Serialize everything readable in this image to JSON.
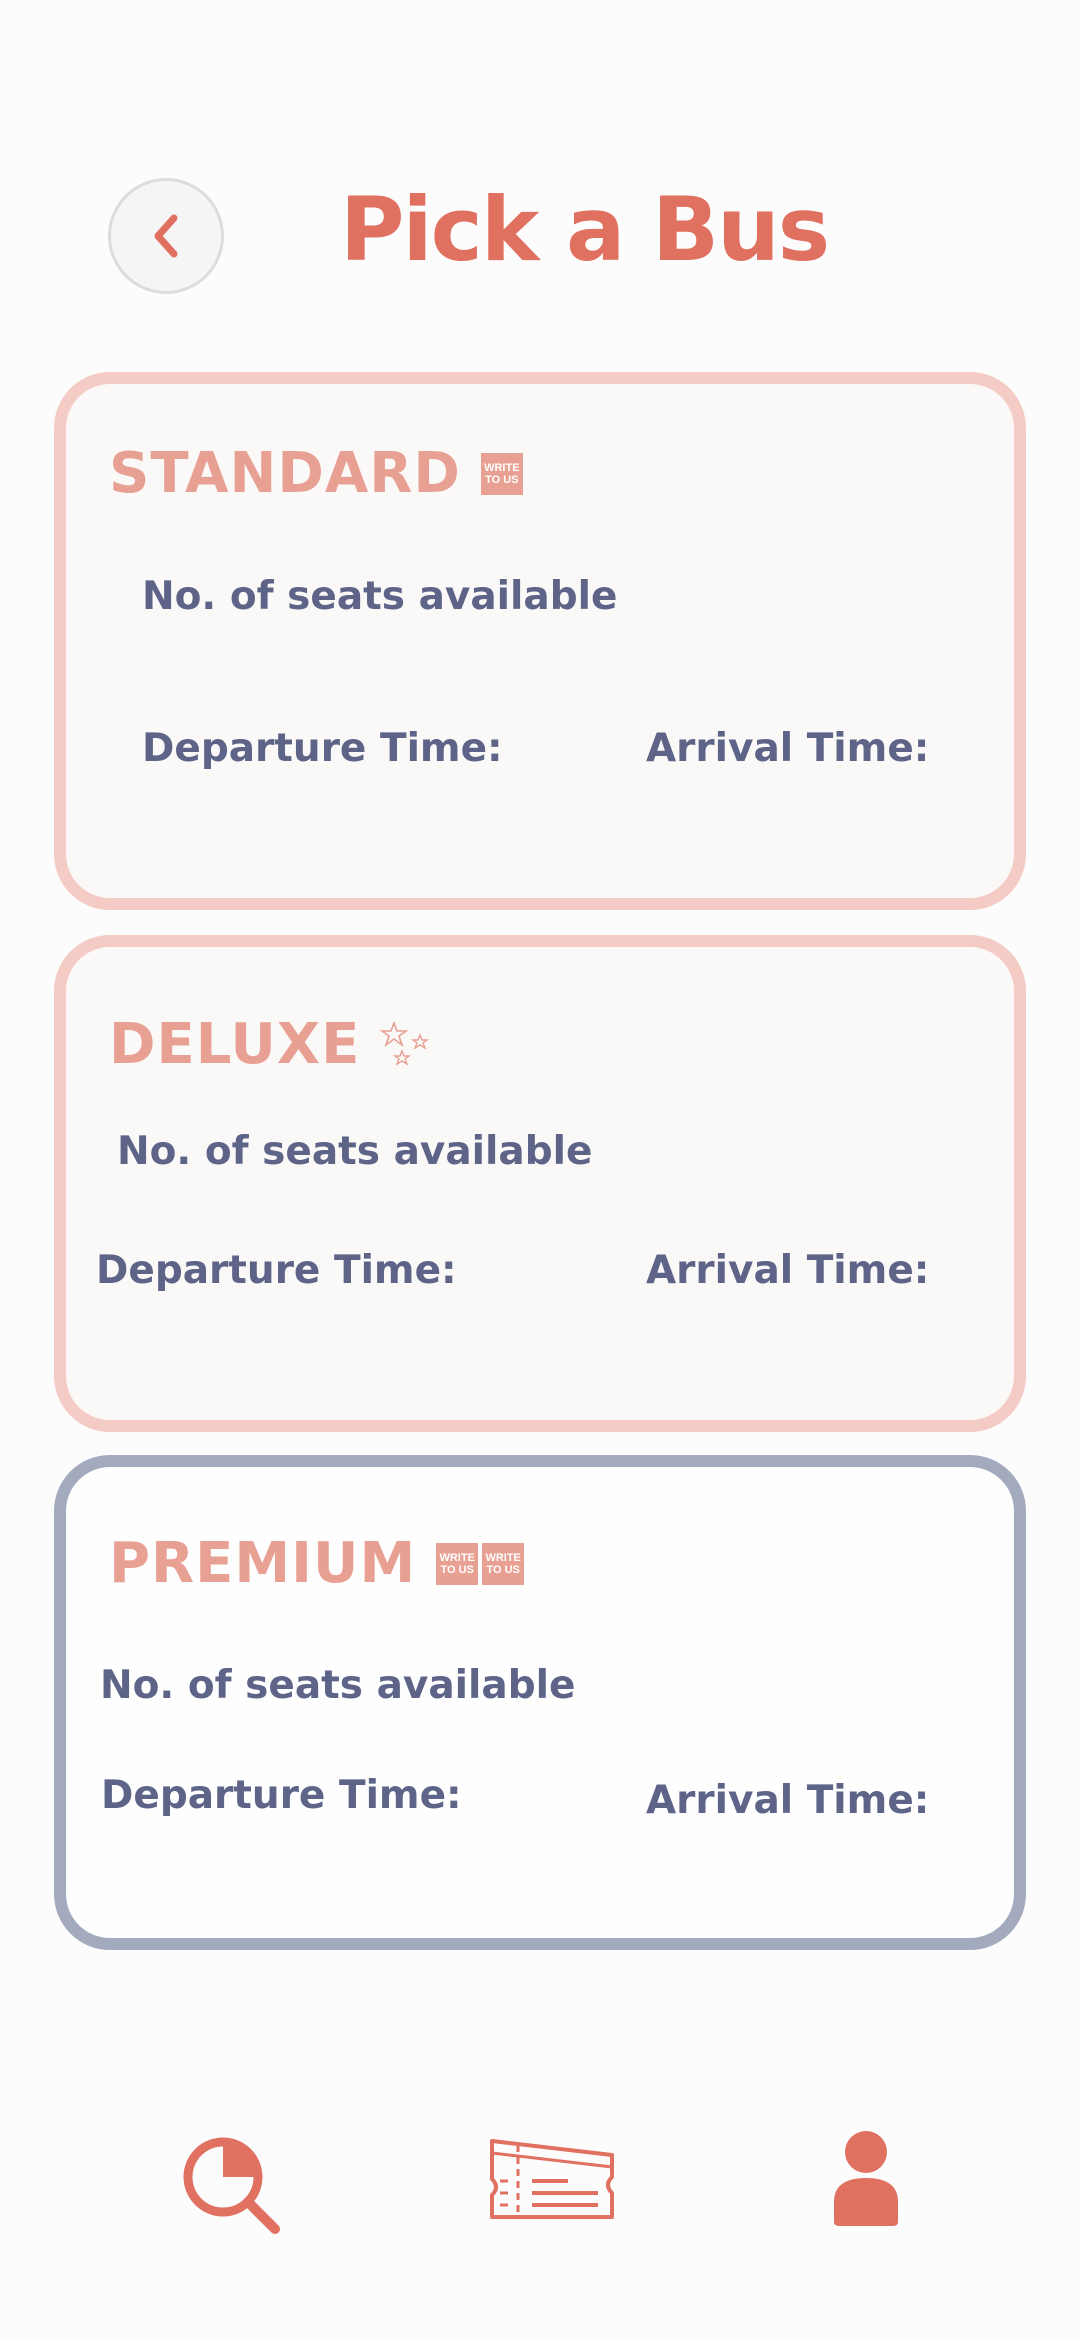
{
  "header": {
    "title": "Pick a Bus",
    "back_icon": "chevron-left-icon"
  },
  "colors": {
    "accent": "#e07060",
    "tier_label": "#e8a093",
    "text": "#5d6488",
    "card_border": "#f4cbc5",
    "premium_border": "#a4aabd"
  },
  "buses": [
    {
      "tier": "STANDARD",
      "badge_icons": [
        "write-to-us-icon"
      ],
      "seats_label": "No. of seats available",
      "departure_label": "Departure Time:",
      "arrival_label": "Arrival Time:"
    },
    {
      "tier": "DELUXE",
      "badge_icons": [
        "stars-icon"
      ],
      "seats_label": "No. of seats available",
      "departure_label": "Departure Time:",
      "arrival_label": "Arrival Time:"
    },
    {
      "tier": "PREMIUM",
      "badge_icons": [
        "write-to-us-icon",
        "write-to-us-icon"
      ],
      "seats_label": "No. of seats available",
      "departure_label": "Departure Time:",
      "arrival_label": "Arrival Time:"
    }
  ],
  "badge_text": {
    "line1": "WRITE",
    "line2": "TO US"
  },
  "bottom_nav": [
    {
      "icon": "search-icon"
    },
    {
      "icon": "ticket-icon"
    },
    {
      "icon": "user-profile-icon"
    }
  ]
}
